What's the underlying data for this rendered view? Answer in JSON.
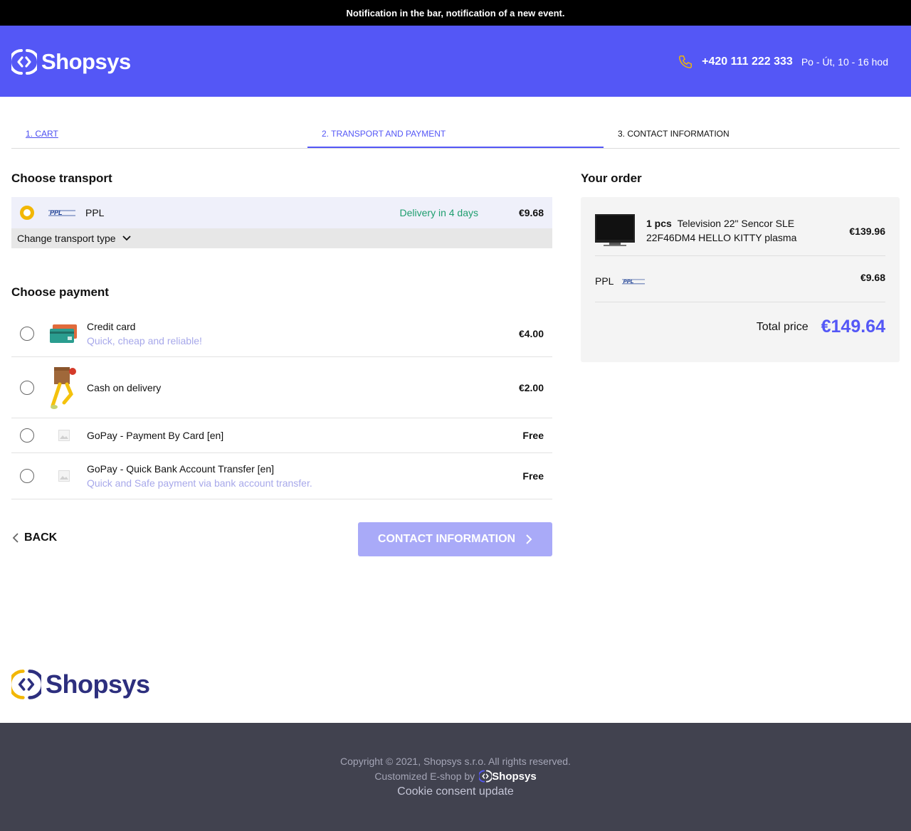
{
  "notification": "Notification in the bar, notification of a new event.",
  "header": {
    "logo_text": "Shopsys",
    "phone": "+420 111 222 333",
    "hours": "Po - Út, 10 - 16 hod"
  },
  "steps": [
    {
      "label": "1. CART"
    },
    {
      "label": "2. TRANSPORT AND PAYMENT"
    },
    {
      "label": "3. CONTACT INFORMATION"
    }
  ],
  "transport": {
    "title": "Choose transport",
    "selected": {
      "name": "PPL",
      "delivery": "Delivery in 4 days",
      "price": "€9.68"
    },
    "change_label": "Change transport type"
  },
  "payment": {
    "title": "Choose payment",
    "options": [
      {
        "name": "Credit card",
        "desc": "Quick, cheap and reliable!",
        "price": "€4.00"
      },
      {
        "name": "Cash on delivery",
        "desc": "",
        "price": "€2.00"
      },
      {
        "name": "GoPay - Payment By Card [en]",
        "desc": "",
        "price": "Free"
      },
      {
        "name": "GoPay - Quick Bank Account Transfer [en]",
        "desc": "Quick and Safe payment via bank account transfer.",
        "price": "Free"
      }
    ]
  },
  "nav": {
    "back_label": "BACK",
    "continue_label": "CONTACT INFORMATION"
  },
  "order": {
    "title": "Your order",
    "item": {
      "qty": "1 pcs",
      "name": "Television 22\" Sencor SLE 22F46DM4 HELLO KITTY plasma",
      "price": "€139.96"
    },
    "transport": {
      "name": "PPL",
      "price": "€9.68"
    },
    "total_label": "Total price",
    "total_value": "€149.64"
  },
  "footer": {
    "logo_text": "Shopsys",
    "copyright": "Copyright © 2021, Shopsys s.r.o. All rights reserved.",
    "customized": "Customized E-shop by",
    "by_logo_text": "Shopsys",
    "cookie": "Cookie consent update"
  },
  "colors": {
    "accent": "#5457f6",
    "radio_selected": "#f2b705",
    "delivery": "#1f9e6f",
    "footer_bg": "#41424f"
  }
}
